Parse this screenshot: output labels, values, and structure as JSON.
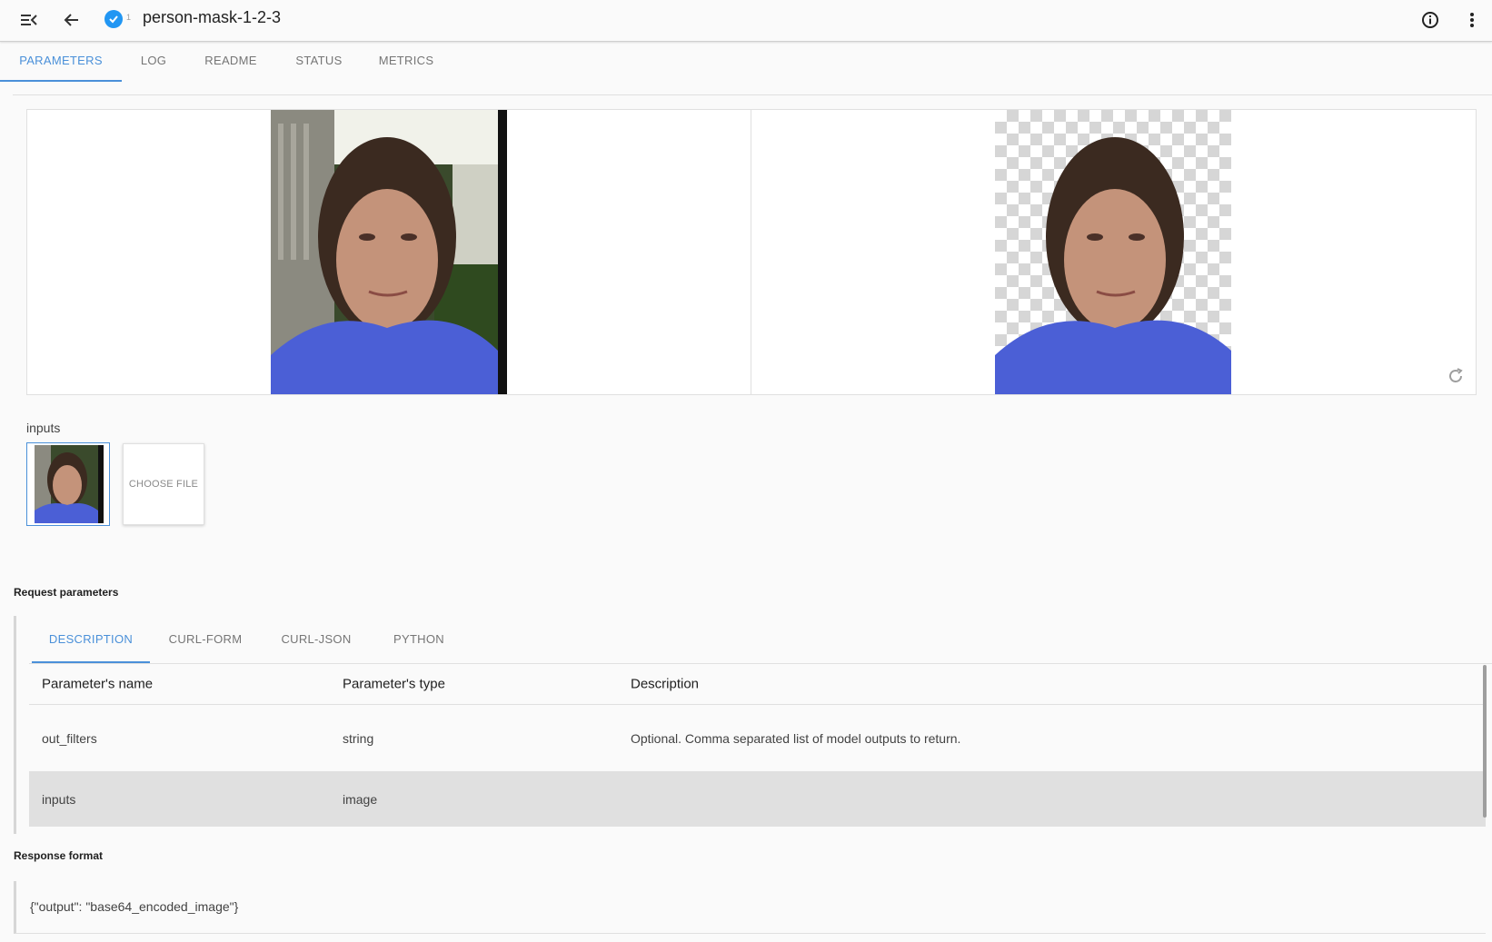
{
  "app": {
    "title": "person-mask-1-2-3",
    "verified_count": "1"
  },
  "toolbar": {
    "menu_icon": "menu-collapse-icon",
    "back_icon": "arrow-back-icon",
    "info_icon": "info-icon",
    "more_icon": "more-vert-icon"
  },
  "tabs": [
    {
      "label": "PARAMETERS",
      "active": true
    },
    {
      "label": "LOG"
    },
    {
      "label": "README"
    },
    {
      "label": "STATUS"
    },
    {
      "label": "METRICS"
    }
  ],
  "preview": {
    "input_image": "person-photo",
    "output_image": "person-masked-photo",
    "refresh_icon": "refresh-icon"
  },
  "inputs": {
    "label": "inputs",
    "choose_file": "CHOOSE FILE"
  },
  "request": {
    "title": "Request parameters",
    "subtabs": [
      {
        "label": "DESCRIPTION",
        "active": true
      },
      {
        "label": "CURL-FORM"
      },
      {
        "label": "CURL-JSON"
      },
      {
        "label": "PYTHON"
      }
    ],
    "columns": [
      "Parameter's name",
      "Parameter's type",
      "Description"
    ],
    "rows": [
      {
        "name": "out_filters",
        "type": "string",
        "description": "Optional. Comma separated list of model outputs to return."
      },
      {
        "name": "inputs",
        "type": "image",
        "description": ""
      }
    ]
  },
  "response": {
    "title": "Response format",
    "body": "{\"output\": \"base64_encoded_image\"}"
  },
  "colors": {
    "accent": "#4a90d9",
    "verified": "#2196f3",
    "shirt": "#4b5fd6"
  }
}
